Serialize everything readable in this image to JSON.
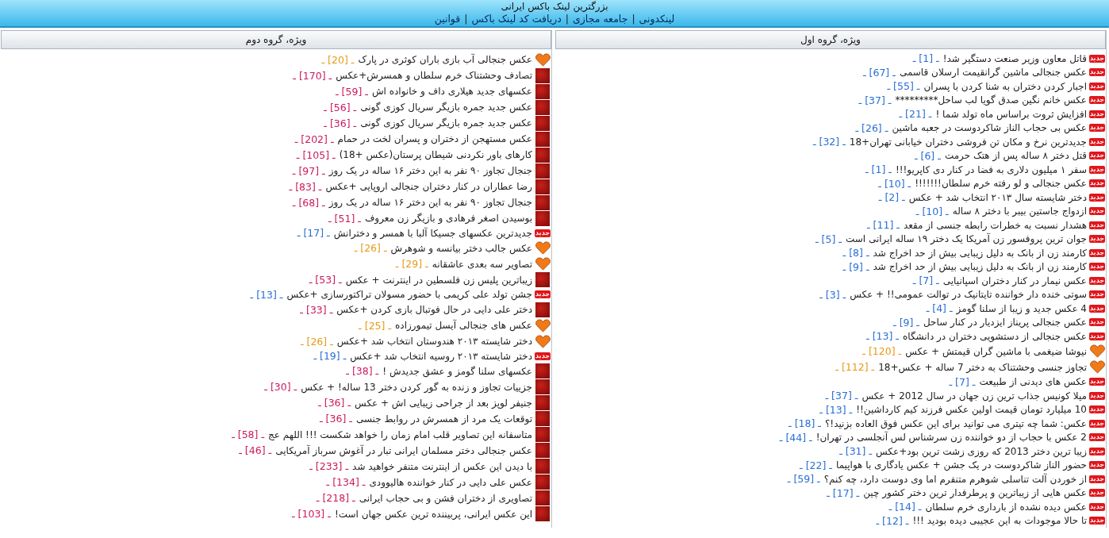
{
  "header": {
    "title": "بزرگترین لینک باکس ایرانی",
    "nav": [
      {
        "label": "لینکدونی"
      },
      {
        "label": "جامعه مجازی"
      },
      {
        "label": "دریافت کد لینک باکس"
      },
      {
        "label": "قوانین"
      }
    ],
    "separator": "|"
  },
  "groups": [
    {
      "title": "ویژه، گروه اول",
      "items": [
        {
          "kind": "new",
          "badge": "جدید",
          "title": "قاتل معاون وزیر صنعت دستگیر شد!",
          "count": "ـ [1] ـ"
        },
        {
          "kind": "new",
          "badge": "جدید",
          "title": "عکس جنجالی ماشین گرانقیمت ارسلان قاسمی",
          "count": "ـ [67] ـ"
        },
        {
          "kind": "new",
          "badge": "جدید",
          "title": "اجبار کردن دختران به شنا کردن با پسران",
          "count": "ـ [55] ـ"
        },
        {
          "kind": "new",
          "badge": "جدید",
          "title": "عکس خانم نگین صدق گویا لب ساحل*********",
          "count": "ـ [37] ـ"
        },
        {
          "kind": "new",
          "badge": "جدید",
          "title": "افزایش ثروت براساس ماه تولد شما !",
          "count": "ـ [21] ـ"
        },
        {
          "kind": "new",
          "badge": "جدید",
          "title": "عکس بی حجاب الناز شاکردوست در جعبه ماشین",
          "count": "ـ [26] ـ"
        },
        {
          "kind": "new",
          "badge": "جدید",
          "title": "جدیدترین نرخ و مکان تن فروشی دختران خیابانی تهران+18",
          "count": "ـ [32] ـ"
        },
        {
          "kind": "new",
          "badge": "جدید",
          "title": "قتل دختر ۸ ساله پس از هتک حرمت",
          "count": "ـ [6] ـ"
        },
        {
          "kind": "new",
          "badge": "جدید",
          "title": "سفر ۱ میلیون دلاری به فضا در کنار دی کاپریو!!!",
          "count": "ـ [1] ـ"
        },
        {
          "kind": "new",
          "badge": "جدید",
          "title": "عکس جنجالی و لو رفته خرم سلطان!!!!!!!",
          "count": "ـ [10] ـ"
        },
        {
          "kind": "new",
          "badge": "جدید",
          "title": "دختر شایسته سال ۲۰۱۳ انتخاب شد + عکس",
          "count": "ـ [2] ـ"
        },
        {
          "kind": "new",
          "badge": "جدید",
          "title": "ازدواج جاستین بیبر با دختر ۸ ساله",
          "count": "ـ [10] ـ"
        },
        {
          "kind": "new",
          "badge": "جدید",
          "title": "هشدار نسبت به خطرات رابطه جنسی از مقعد",
          "count": "ـ [11] ـ"
        },
        {
          "kind": "new",
          "badge": "جدید",
          "title": "جوان ترین پروفسور زن آمریکا یک دختر ۱۹ ساله ایرانی است",
          "count": "ـ [5] ـ"
        },
        {
          "kind": "new",
          "badge": "جدید",
          "title": "کارمند زن از بانک به دلیل زیبایی بیش از حد اخراج شد",
          "count": "ـ [8] ـ"
        },
        {
          "kind": "new",
          "badge": "جدید",
          "title": "کارمند زن از بانک به دلیل زیبایی بیش از حد اخراج شد",
          "count": "ـ [9] ـ"
        },
        {
          "kind": "new",
          "badge": "جدید",
          "title": "عکس نیمار در کنار دختران اسپانیایی",
          "count": "ـ [7] ـ"
        },
        {
          "kind": "new",
          "badge": "جدید",
          "title": "سوتی خنده دار خواننده تایتانیک در توالت عمومی!! + عکس",
          "count": "ـ [3] ـ"
        },
        {
          "kind": "new",
          "badge": "جدید",
          "title": "4 عکس جدید و زیبا از سلنا گومز",
          "count": "ـ [4] ـ"
        },
        {
          "kind": "new",
          "badge": "جدید",
          "title": "عکس جنجالی پریناز ایزدیار در کنار ساحل",
          "count": "ـ [9] ـ"
        },
        {
          "kind": "new",
          "badge": "جدید",
          "title": "عکس جنجالی از دستشویی دختران در دانشگاه",
          "count": "ـ [13] ـ"
        },
        {
          "kind": "heart",
          "title": "نیوشا ضیغمی با ماشین گران قیمتش + عکس",
          "count": "ـ [120] ـ"
        },
        {
          "kind": "heart",
          "title": "تجاوز جنسی وحشتناک به دختر 7 ساله + عکس+18",
          "count": "ـ [112] ـ"
        },
        {
          "kind": "new",
          "badge": "جدید",
          "title": "عکس های دیدنی از طبیعت",
          "count": "ـ [7] ـ"
        },
        {
          "kind": "new",
          "badge": "جدید",
          "title": "میلا کونیس جذاب ترین زن جهان در سال 2012 + عکس",
          "count": "ـ [37] ـ"
        },
        {
          "kind": "new",
          "badge": "جدید",
          "title": "10 میلیارد تومان قیمت اولین عکس فرزند کیم کارداشین!!",
          "count": "ـ [13] ـ"
        },
        {
          "kind": "new",
          "badge": "جدید",
          "title": "عکس: شما چه تیتری می توانید برای این عکس فوق العاده بزنید!؟",
          "count": "ـ [18] ـ"
        },
        {
          "kind": "new",
          "badge": "جدید",
          "title": "2 عکس با حجاب از دو خواننده زن سرشناس لس آنجلسی در تهران!",
          "count": "ـ [44] ـ"
        },
        {
          "kind": "new",
          "badge": "جدید",
          "title": "زیبا ترین دختر 2013 که روزی زشت ترین بود+عکس",
          "count": "ـ [31] ـ"
        },
        {
          "kind": "new",
          "badge": "جدید",
          "title": "حضور الناز شاکردوست در یک جشن + عکس یادگاری با هواپیما",
          "count": "ـ [22] ـ"
        },
        {
          "kind": "new",
          "badge": "جدید",
          "title": "از خوردن آلت تناسلی شوهرم متنفرم اما وی دوست دارد، چه کنم؟",
          "count": "ـ [59] ـ"
        },
        {
          "kind": "new",
          "badge": "جدید",
          "title": "عکس هایی از زیباترین و پرطرفدار ترین دختر کشور چین",
          "count": "ـ [17] ـ"
        },
        {
          "kind": "new",
          "badge": "جدید",
          "title": "عکس دیده نشده از بارداری خرم سلطان",
          "count": "ـ [14] ـ"
        },
        {
          "kind": "new",
          "badge": "جدید",
          "title": "تا حالا موجودات به این عجیبی دیده بودید !!!",
          "count": "ـ [12] ـ"
        }
      ]
    },
    {
      "title": "ویژه، گروه دوم",
      "items": [
        {
          "kind": "heart",
          "title": "عکس جنجالی آب بازی باران کوثری در پارک",
          "count": "ـ [20] ـ"
        },
        {
          "kind": "square",
          "title": "تصادف وحشتناک خرم سلطان و همسرش+عکس",
          "count": "ـ [170] ـ"
        },
        {
          "kind": "square",
          "title": "عکسهای جدید هیلاری داف و خانواده اش",
          "count": "ـ [59] ـ"
        },
        {
          "kind": "square",
          "title": "عکس جدید جمره بازیگر سریال کوزی گونی",
          "count": "ـ [56] ـ"
        },
        {
          "kind": "square",
          "title": "عکس جدید جمره بازیگر سریال کوزی گونی",
          "count": "ـ [36] ـ"
        },
        {
          "kind": "square",
          "title": "عکس مستهجن از دختران و پسران لخت در حمام",
          "count": "ـ [202] ـ"
        },
        {
          "kind": "square",
          "title": "کارهای باور نکردنی شیطان پرستان(عکس +18)",
          "count": "ـ [105] ـ"
        },
        {
          "kind": "square",
          "title": "جنجال تجاوز ۹۰ نفر به این دختر ۱۶ ساله در یک روز",
          "count": "ـ [97] ـ"
        },
        {
          "kind": "square",
          "title": "رضا عطاران در کنار دختران جنجالی اروپایی +عکس",
          "count": "ـ [83] ـ"
        },
        {
          "kind": "square",
          "title": "جنجال تجاوز ۹۰ نفر به این دختر ۱۶ ساله در یک روز",
          "count": "ـ [68] ـ"
        },
        {
          "kind": "square",
          "title": "بوسیدن اصغر فرهادی و بازیگر زن معروف",
          "count": "ـ [51] ـ"
        },
        {
          "kind": "new",
          "badge": "جدید",
          "title": "جدیدترین عکسهای جسیکا آلبا با همسر و دخترانش",
          "count": "ـ [17] ـ"
        },
        {
          "kind": "heart",
          "title": "عکس جالب دختر بیانسه و شوهرش",
          "count": "ـ [26] ـ"
        },
        {
          "kind": "heart",
          "title": "تصاویر سه بعدی عاشقانه",
          "count": "ـ [29] ـ"
        },
        {
          "kind": "square",
          "title": "زیباترین پلیس زن فلسطین در اینترنت + عکس",
          "count": "ـ [53] ـ"
        },
        {
          "kind": "new",
          "badge": "جدید",
          "title": "جشن تولد علی کریمی با حضور مسولان تراکتورسازی +عکس",
          "count": "ـ [13] ـ"
        },
        {
          "kind": "square",
          "title": "دختر علی دایی در حال فوتبال بازی کردن +عکس",
          "count": "ـ [33] ـ"
        },
        {
          "kind": "heart",
          "title": "عکس های جنجالی آیسل تیمورزاده",
          "count": "ـ [25] ـ"
        },
        {
          "kind": "heart",
          "title": "دختر شایسته ۲۰۱۳ هندوستان انتخاب شد +عکس",
          "count": "ـ [26] ـ"
        },
        {
          "kind": "new",
          "badge": "جدید",
          "title": "دختر شایسته ۲۰۱۳ روسیه انتخاب شد +عکس",
          "count": "ـ [19] ـ"
        },
        {
          "kind": "square",
          "title": "عکسهای سلنا گومز و عشق جدیدش !",
          "count": "ـ [38] ـ"
        },
        {
          "kind": "square",
          "title": "جزییات تجاوز و زنده به گور کردن دختر 13 ساله! + عکس",
          "count": "ـ [30] ـ"
        },
        {
          "kind": "square",
          "title": "جنیفر لوپز بعد از جراحی زیبایی اش + عکس",
          "count": "ـ [36] ـ"
        },
        {
          "kind": "square",
          "title": "توقعات یک مرد از همسرش در روابط جنسی",
          "count": "ـ [36] ـ"
        },
        {
          "kind": "square",
          "title": "متاسفانه این تصاویر قلب امام زمان را خواهد شکست !!! اللهم عج",
          "count": "ـ [58] ـ"
        },
        {
          "kind": "square",
          "title": "عکس جنجالی دختر مسلمان ایرانی تبار در آغوش سرباز آمریکایی",
          "count": "ـ [46] ـ"
        },
        {
          "kind": "square",
          "title": "با دیدن این عکس از اینترنت متنفر خواهید شد",
          "count": "ـ [233] ـ"
        },
        {
          "kind": "square",
          "title": "عکس علی دایی در کنار خواننده هالیوودی",
          "count": "ـ [134] ـ"
        },
        {
          "kind": "square",
          "title": "تصاویری از دختران فشن و بی حجاب ایرانی",
          "count": "ـ [218] ـ"
        },
        {
          "kind": "square",
          "title": "این عکس ایرانی، پربیننده ترین عکس جهان است!",
          "count": "ـ [103] ـ"
        }
      ]
    }
  ]
}
